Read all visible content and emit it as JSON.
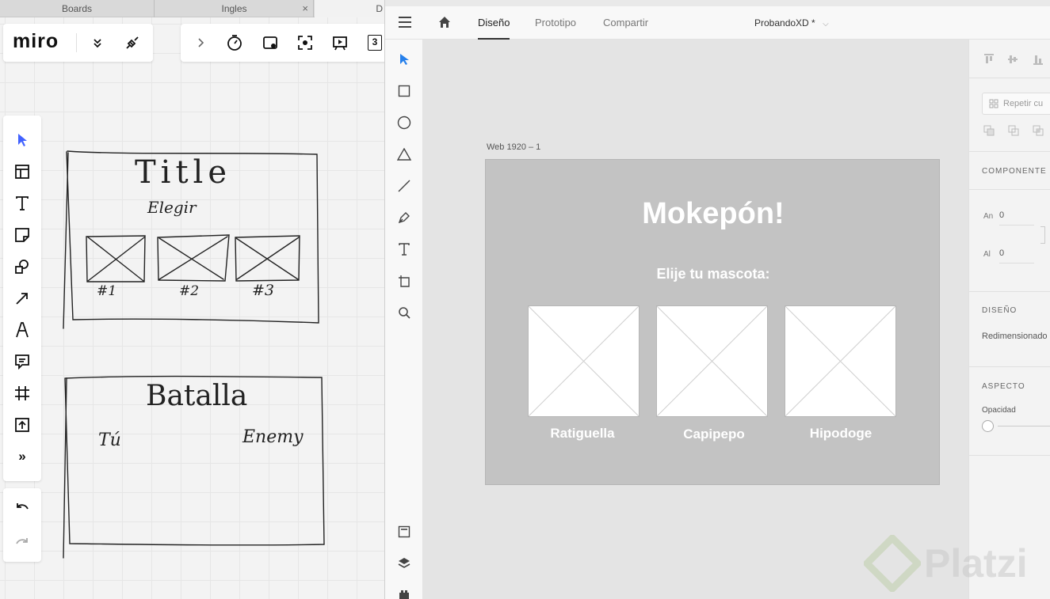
{
  "miro": {
    "tabs": [
      {
        "label": "Boards"
      },
      {
        "label": "Ingles",
        "close": "×"
      },
      {
        "label": "D"
      }
    ],
    "logo": "miro",
    "toolbar_icons": [
      "chevron-right-icon",
      "timer-icon",
      "card-icon",
      "focus-icon",
      "present-icon",
      "count-icon"
    ],
    "count_badge": "3",
    "left_tools": [
      "select-icon",
      "template-icon",
      "text-icon",
      "sticky-note-icon",
      "shapes-icon",
      "arrow-icon",
      "pen-icon",
      "comment-icon",
      "frame-icon",
      "upload-icon",
      "more-icon"
    ],
    "more_glyph": "»",
    "sketch": {
      "frame1": {
        "title": "Title",
        "subtitle": "Elegir",
        "labels": [
          "#1",
          "#2",
          "#3"
        ]
      },
      "frame2": {
        "title": "Batalla",
        "left": "Tú",
        "right": "Enemy"
      }
    }
  },
  "xd": {
    "tabs": [
      {
        "label": "Diseño",
        "active": true
      },
      {
        "label": "Prototipo",
        "active": false
      },
      {
        "label": "Compartir",
        "active": false
      }
    ],
    "doc_title": "ProbandoXD *",
    "artboard_label": "Web 1920 – 1",
    "artboard": {
      "title": "Mokepón!",
      "subtitle": "Elije tu mascota:",
      "pets": [
        "Ratiguella",
        "Capipepo",
        "Hipodoge"
      ]
    },
    "right_panel": {
      "repeat": "Repetir cu",
      "component": "COMPONENTE",
      "width_label": "An",
      "width_value": "0",
      "height_label": "Al",
      "height_value": "0",
      "design": "DISEÑO",
      "resize": "Redimensionado",
      "aspect": "ASPECTO",
      "opacity": "Opacidad"
    },
    "watermark": "Platzi"
  },
  "colors": {
    "accent": "#2680eb",
    "artboard": "#c3c3c3",
    "miro_select": "#4262ff"
  }
}
